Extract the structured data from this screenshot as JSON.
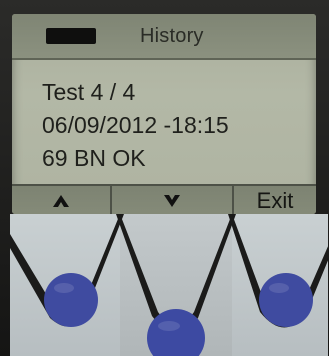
{
  "header": {
    "title": "History",
    "battery_icon": "battery-icon"
  },
  "record": {
    "test_line": "Test 4 / 4",
    "datetime_line": "06/09/2012 -18:15",
    "result_line": "69 BN OK"
  },
  "softkeys": {
    "up_icon": "chevron-up-icon",
    "down_icon": "chevron-down-icon",
    "exit_label": "Exit"
  },
  "colors": {
    "lcd_bg": "#b3b8a6",
    "lcd_text": "#1f201c",
    "button_dot": "#3f4ba0"
  }
}
